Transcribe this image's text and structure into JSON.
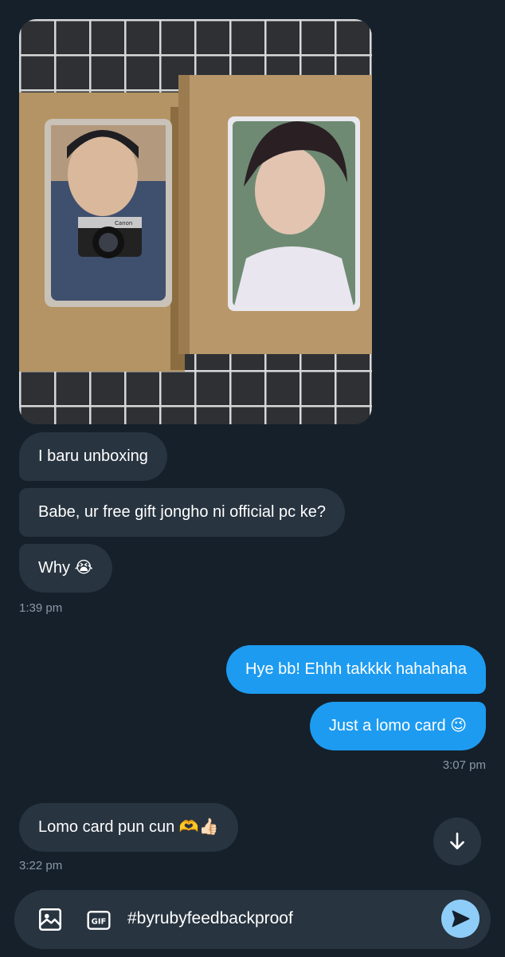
{
  "messages": [
    {
      "id": "m1",
      "direction": "incoming",
      "text": "I baru unboxing"
    },
    {
      "id": "m2",
      "direction": "incoming",
      "text": "Babe, ur free gift jongho ni official pc ke?"
    },
    {
      "id": "m3",
      "direction": "incoming",
      "text": "Why 😭"
    },
    {
      "id": "m4",
      "direction": "outgoing",
      "text": "Hye bb! Ehhh takkkk hahahaha"
    },
    {
      "id": "m5",
      "direction": "outgoing",
      "text": "Just a lomo card 😉"
    },
    {
      "id": "m6",
      "direction": "incoming",
      "text": "Lomo card pun cun 🫶👍🏻"
    }
  ],
  "timestamps": {
    "t1": "1:39 pm",
    "t2": "3:07 pm",
    "t3": "3:22 pm"
  },
  "photo": {
    "alt": "photo of two photocards on cardboard",
    "card_text": "Canon"
  },
  "composer": {
    "value": "#byrubyfeedbackproof",
    "gif_label": "GIF",
    "image_icon": "image-icon",
    "send_icon": "send-icon"
  },
  "colors": {
    "background": "#15202b",
    "incoming_bubble": "#283440",
    "outgoing_bubble": "#1d9bf0",
    "timestamp": "#8b98a5",
    "send_button": "#8ecdf8"
  }
}
